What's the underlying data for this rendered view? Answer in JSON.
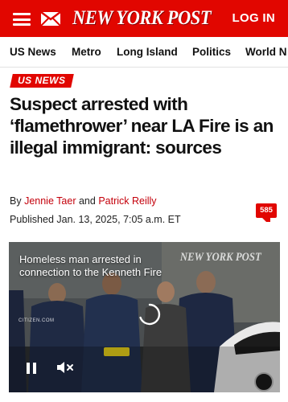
{
  "header": {
    "logo_text": "NEW YORK POST",
    "login_label": "LOG IN",
    "brand_color": "#e10600",
    "icons": [
      "hamburger-menu-icon",
      "mail-icon"
    ]
  },
  "nav": {
    "items": [
      {
        "label": "US News"
      },
      {
        "label": "Metro"
      },
      {
        "label": "Long Island"
      },
      {
        "label": "Politics"
      },
      {
        "label": "World N"
      }
    ]
  },
  "article": {
    "section": "US NEWS",
    "headline": "Suspect arrested with ‘flamethrower’ near LA Fire is an illegal immigrant: sources",
    "byline": {
      "prefix": "By",
      "author_1": "Jennie Taer",
      "joiner": "and",
      "author_2": "Patrick Reilly"
    },
    "published": "Published Jan. 13, 2025, 7:05 a.m. ET",
    "comment_count": "585"
  },
  "video": {
    "caption": "Homeless man arrested in connection to the Kenneth Fire",
    "watermark_logo": "NEW YORK POST",
    "source_watermark": "CITIZEN.COM",
    "icons": [
      "pause-icon",
      "muted-speaker-icon",
      "loading-spinner-icon"
    ]
  }
}
